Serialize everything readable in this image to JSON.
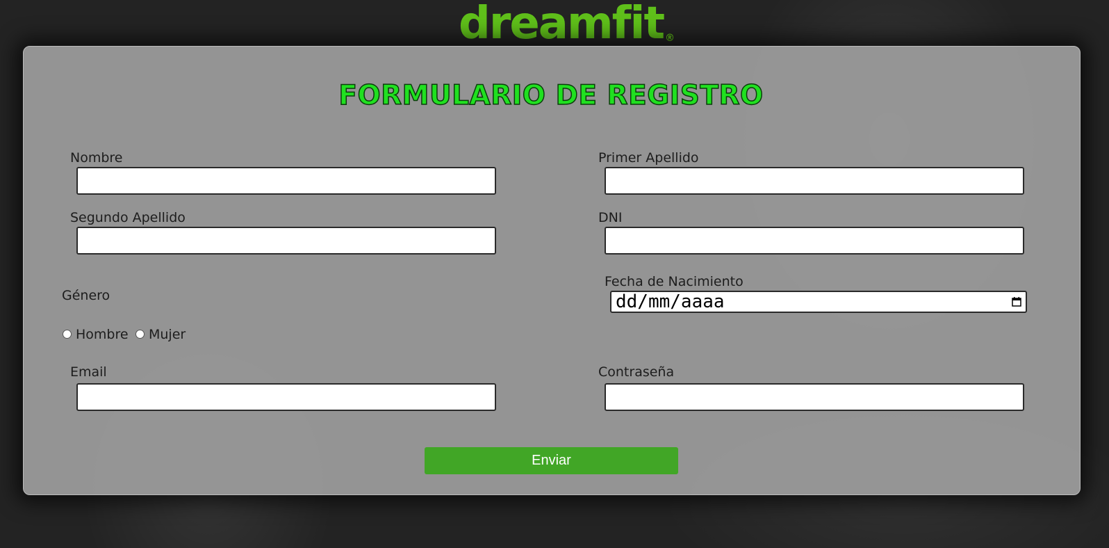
{
  "logo": {
    "text": "dreamfit",
    "registered": "®"
  },
  "form": {
    "title": "FORMULARIO DE REGISTRO",
    "fields": {
      "nombre": {
        "label": "Nombre",
        "value": ""
      },
      "primer_apellido": {
        "label": "Primer Apellido",
        "value": ""
      },
      "segundo_apellido": {
        "label": "Segundo Apellido",
        "value": ""
      },
      "dni": {
        "label": "DNI",
        "value": ""
      },
      "fecha_nacimiento": {
        "label": "Fecha de Nacimiento",
        "placeholder": "dd/mm/aaaa"
      },
      "email": {
        "label": "Email",
        "value": ""
      },
      "contrasena": {
        "label": "Contraseña",
        "value": ""
      }
    },
    "genero": {
      "label": "Género",
      "options": [
        "Hombre",
        "Mujer"
      ],
      "selected": null
    },
    "submit_label": "Enviar"
  },
  "colors": {
    "brand_green": "#5fbf1a",
    "title_green": "#20e020",
    "button_green": "#41a626",
    "card_bg": "#9b9b9b",
    "page_bg": "#232323"
  }
}
